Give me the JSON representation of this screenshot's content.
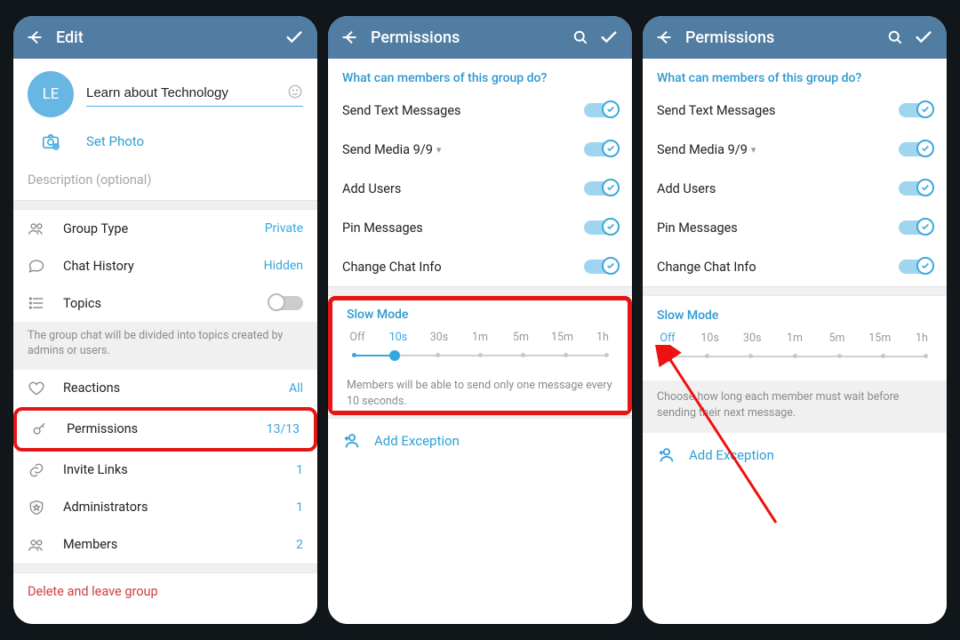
{
  "screen1": {
    "title": "Edit",
    "avatar_initials": "LE",
    "group_name": "Learn about Technology",
    "set_photo": "Set Photo",
    "description_placeholder": "Description (optional)",
    "rows": {
      "group_type": {
        "label": "Group Type",
        "value": "Private"
      },
      "chat_history": {
        "label": "Chat History",
        "value": "Hidden"
      },
      "topics": {
        "label": "Topics"
      }
    },
    "topics_hint": "The group chat will be divided into topics created by admins or users.",
    "rows2": {
      "reactions": {
        "label": "Reactions",
        "value": "All"
      },
      "permissions": {
        "label": "Permissions",
        "value": "13/13"
      },
      "invite_links": {
        "label": "Invite Links",
        "value": "1"
      },
      "administrators": {
        "label": "Administrators",
        "value": "1"
      },
      "members": {
        "label": "Members",
        "value": "2"
      }
    },
    "delete": "Delete and leave group"
  },
  "perm": {
    "title": "Permissions",
    "section_q": "What can members of this group do?",
    "items": {
      "send_text": "Send Text Messages",
      "send_media": "Send Media 9/9",
      "add_users": "Add Users",
      "pin_messages": "Pin Messages",
      "change_info": "Change Chat Info"
    },
    "slow_mode": "Slow Mode",
    "slider": [
      "Off",
      "10s",
      "30s",
      "1m",
      "5m",
      "15m",
      "1h"
    ],
    "hint_10s": "Members will be able to send only one message every 10 seconds.",
    "hint_off": "Choose how long each member must wait before sending their next message.",
    "add_exception": "Add Exception"
  }
}
